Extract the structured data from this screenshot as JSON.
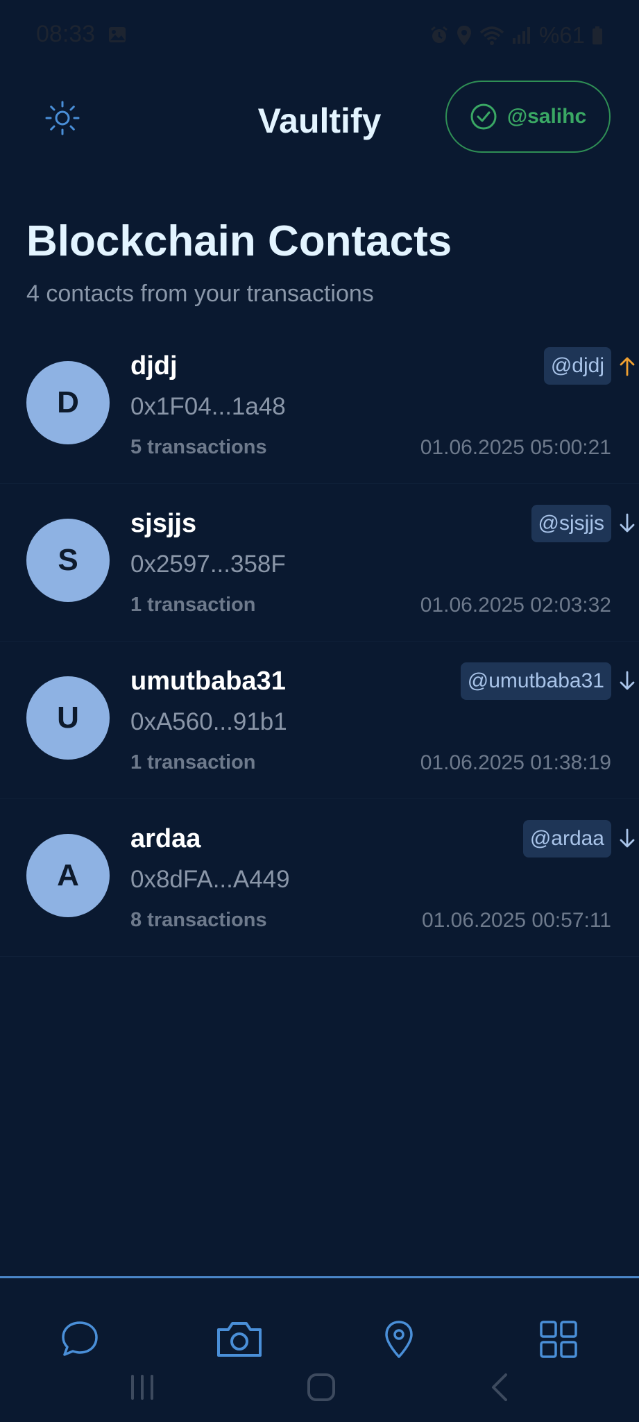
{
  "status_bar": {
    "time": "08:33",
    "battery": "%61",
    "icons": [
      "gallery-icon",
      "alarm-icon",
      "location-icon",
      "wifi-icon",
      "signal-icon",
      "battery-icon"
    ]
  },
  "header": {
    "settings_icon": "sun-icon",
    "title": "Vaultify",
    "user_chip": "@salihc",
    "user_chip_icon": "check-circle-icon"
  },
  "page": {
    "title": "Blockchain Contacts",
    "subtitle": "4 contacts from your transactions"
  },
  "contacts": [
    {
      "initial": "D",
      "name": "djdj",
      "address": "0x1F04...1a48",
      "transactions": "5 transactions",
      "date": "01.06.2025 05:00:21",
      "handle": "@djdj",
      "direction": "up-arrow-icon"
    },
    {
      "initial": "S",
      "name": "sjsjjs",
      "address": "0x2597...358F",
      "transactions": "1 transaction",
      "date": "01.06.2025 02:03:32",
      "handle": "@sjsjjs",
      "direction": "down-arrow-icon"
    },
    {
      "initial": "U",
      "name": "umutbaba31",
      "address": "0xA560...91b1",
      "transactions": "1 transaction",
      "date": "01.06.2025 01:38:19",
      "handle": "@umutbaba31",
      "direction": "down-arrow-icon"
    },
    {
      "initial": "A",
      "name": "ardaa",
      "address": "0x8dFA...A449",
      "transactions": "8 transactions",
      "date": "01.06.2025 00:57:11",
      "handle": "@ardaa",
      "direction": "down-arrow-icon"
    }
  ],
  "bottom_nav": {
    "items": [
      "chat-icon",
      "camera-icon",
      "location-pin-icon",
      "grid-icon"
    ]
  },
  "system_nav": {
    "items": [
      "recent-apps-icon",
      "home-icon",
      "back-icon"
    ]
  },
  "colors": {
    "background": "#0a1930",
    "accent": "#4a86c8",
    "verified_green": "#3aa864",
    "outgoing_orange": "#f0a030",
    "avatar": "#8eb2e3",
    "badge": "#1e3556"
  }
}
